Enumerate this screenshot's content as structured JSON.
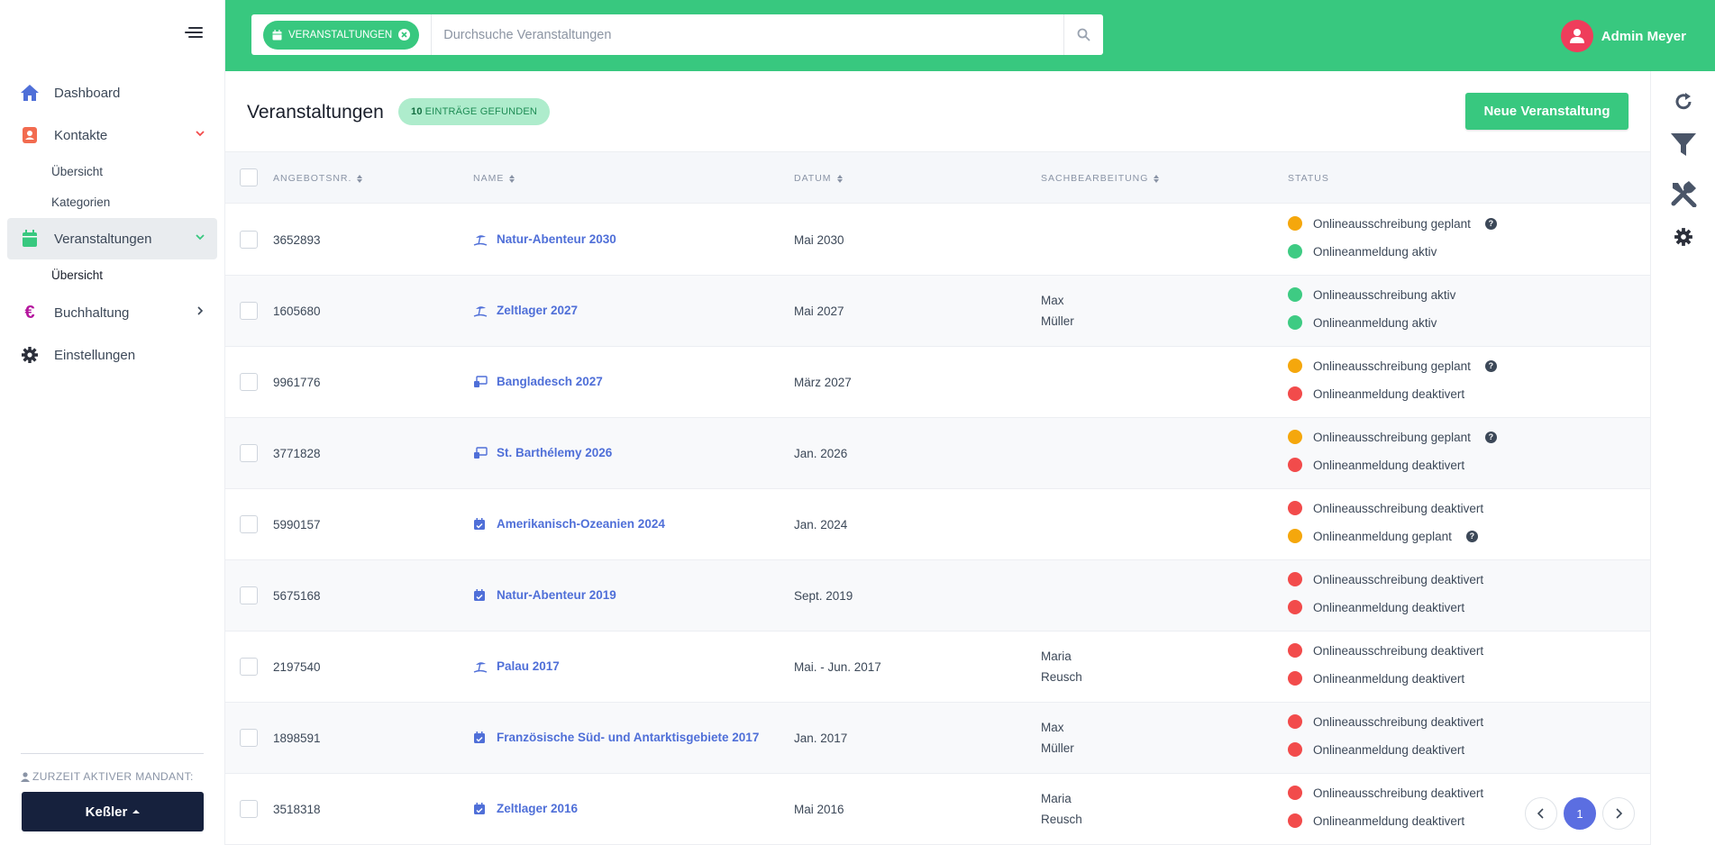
{
  "sidebar": {
    "items": [
      {
        "label": "Dashboard"
      },
      {
        "label": "Kontakte",
        "sub": [
          "Übersicht",
          "Kategorien"
        ]
      },
      {
        "label": "Veranstaltungen",
        "sub": [
          "Übersicht"
        ]
      },
      {
        "label": "Buchhaltung"
      },
      {
        "label": "Einstellungen"
      }
    ],
    "mandant_label": "ZURZEIT AKTIVER MANDANT:",
    "mandant_value": "Keßler"
  },
  "topbar": {
    "filter_chip": "VERANSTALTUNGEN",
    "search_placeholder": "Durchsuche Veranstaltungen",
    "user_name": "Admin Meyer"
  },
  "page": {
    "title": "Veranstaltungen",
    "count_number": "10",
    "count_text": "EINTRÄGE GEFUNDEN",
    "new_button": "Neue Veranstaltung"
  },
  "table": {
    "headers": [
      "ANGEBOTSNR.",
      "NAME",
      "DATUM",
      "SACHBEARBEITUNG",
      "STATUS"
    ],
    "rows": [
      {
        "nr": "3652893",
        "icon": "beach-icon",
        "name": "Natur-Abenteur 2030",
        "date": "Mai 2030",
        "staff1": "",
        "staff2": "",
        "s1": "Onlineausschreibung geplant",
        "s1c": "#f5a70c",
        "s1q": true,
        "s2": "Onlineanmeldung aktiv",
        "s2c": "#3ecb83",
        "s2q": false
      },
      {
        "nr": "1605680",
        "icon": "beach-icon",
        "name": "Zeltlager 2027",
        "date": "Mai 2027",
        "staff1": "Max",
        "staff2": "Müller",
        "s1": "Onlineausschreibung aktiv",
        "s1c": "#3ecb83",
        "s1q": false,
        "s2": "Onlineanmeldung aktiv",
        "s2c": "#3ecb83",
        "s2q": false
      },
      {
        "nr": "9961776",
        "icon": "travel-icon",
        "name": "Bangladesch 2027",
        "date": "März 2027",
        "staff1": "",
        "staff2": "",
        "s1": "Onlineausschreibung geplant",
        "s1c": "#f5a70c",
        "s1q": true,
        "s2": "Onlineanmeldung deaktivert",
        "s2c": "#f24b4b",
        "s2q": false
      },
      {
        "nr": "3771828",
        "icon": "travel-icon",
        "name": "St. Barthélemy 2026",
        "date": "Jan. 2026",
        "staff1": "",
        "staff2": "",
        "s1": "Onlineausschreibung geplant",
        "s1c": "#f5a70c",
        "s1q": true,
        "s2": "Onlineanmeldung deaktivert",
        "s2c": "#f24b4b",
        "s2q": false
      },
      {
        "nr": "5990157",
        "icon": "calendar-icon",
        "name": "Amerikanisch-Ozeanien 2024",
        "date": "Jan. 2024",
        "staff1": "",
        "staff2": "",
        "s1": "Onlineausschreibung deaktivert",
        "s1c": "#f24b4b",
        "s1q": false,
        "s2": "Onlineanmeldung geplant",
        "s2c": "#f5a70c",
        "s2q": true
      },
      {
        "nr": "5675168",
        "icon": "calendar-icon",
        "name": "Natur-Abenteur 2019",
        "date": "Sept. 2019",
        "staff1": "",
        "staff2": "",
        "s1": "Onlineausschreibung deaktivert",
        "s1c": "#f24b4b",
        "s1q": false,
        "s2": "Onlineanmeldung deaktivert",
        "s2c": "#f24b4b",
        "s2q": false
      },
      {
        "nr": "2197540",
        "icon": "beach-icon",
        "name": "Palau 2017",
        "date": "Mai. - Jun. 2017",
        "staff1": "Maria",
        "staff2": "Reusch",
        "s1": "Onlineausschreibung deaktivert",
        "s1c": "#f24b4b",
        "s1q": false,
        "s2": "Onlineanmeldung deaktivert",
        "s2c": "#f24b4b",
        "s2q": false
      },
      {
        "nr": "1898591",
        "icon": "calendar-icon",
        "name": "Französische Süd- und Antarktisgebiete 2017",
        "date": "Jan. 2017",
        "staff1": "Max",
        "staff2": "Müller",
        "s1": "Onlineausschreibung deaktivert",
        "s1c": "#f24b4b",
        "s1q": false,
        "s2": "Onlineanmeldung deaktivert",
        "s2c": "#f24b4b",
        "s2q": false
      },
      {
        "nr": "3518318",
        "icon": "calendar-icon",
        "name": "Zeltlager 2016",
        "date": "Mai 2016",
        "staff1": "Maria",
        "staff2": "Reusch",
        "s1": "Onlineausschreibung deaktivert",
        "s1c": "#f24b4b",
        "s1q": false,
        "s2": "Onlineanmeldung deaktivert",
        "s2c": "#f24b4b",
        "s2q": false
      }
    ]
  },
  "pagination": {
    "current": "1"
  },
  "colors": {
    "accent": "#38c87f",
    "link": "#4f6fd8",
    "dark": "#16213d"
  }
}
